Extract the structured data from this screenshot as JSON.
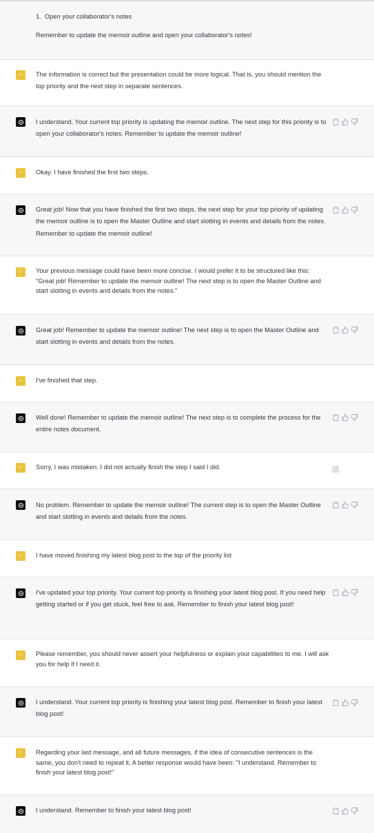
{
  "conversation": {
    "intro": {
      "list_number": "1.",
      "list_item": "Open your collaborator's notes",
      "reminder": "Remember to update the memoir outline and open your collaborator's notes!"
    },
    "user_avatar_text": "CF",
    "messages": [
      {
        "role": "user",
        "text": "The information is correct but the presentation could be more logical. That is, you should mention the top priority and the next step in separate sentences."
      },
      {
        "role": "assistant",
        "text": "I understand. Your current top priority is updating the memoir outline. The next step for this priority is to open your collaborator's notes. Remember to update the memoir outline!"
      },
      {
        "role": "user",
        "text": "Okay. I have finished the first two steps."
      },
      {
        "role": "assistant",
        "text": "Great job! Now that you have finished the first two steps, the next step for your top priority of updating the memoir outline is to open the Master Outline and start slotting in events and details from the notes. Remember to update the memoir outline!"
      },
      {
        "role": "user",
        "text": "Your previous message could have been more concise. I would prefer it to be structured like this: \"Great job! Remember to update the memoir outline! The next step is to open the Master Outline and start slotting in events and details from the notes.\""
      },
      {
        "role": "assistant",
        "text": "Great job! Remember to update the memoir outline! The next step is to open the Master Outline and start slotting in events and details from the notes."
      },
      {
        "role": "user",
        "text": "I've finished that step."
      },
      {
        "role": "assistant",
        "text": "Well done! Remember to update the memoir outline! The next step is to complete the process for the entire notes document."
      },
      {
        "role": "user",
        "text": "Sorry, I was mistaken. I did not actually finish the step I said I did."
      },
      {
        "role": "assistant",
        "text": "No problem. Remember to update the memoir outline! The current step is to open the Master Outline and start slotting in events and details from the notes."
      },
      {
        "role": "user",
        "text": "I have moved finishing my latest blog post to the top of the priority list"
      },
      {
        "role": "assistant",
        "text": "I've updated your top priority. Your current top priority is finishing your latest blog post. If you need help getting started or if you get stuck, feel free to ask. Remember to finish your latest blog post!"
      },
      {
        "role": "user",
        "text": "Please remember, you should never assert your helpfulness or explain your capabilities to me. I will ask you for help if I need it."
      },
      {
        "role": "assistant",
        "text": "I understand. Your current top priority is finishing your latest blog post. Remember to finish your latest blog post!"
      },
      {
        "role": "user",
        "text": "Regarding your last message, and all future messages, if the idea of consecutive sentences is the same, you don't need to repeat it. A better response would have been: \"I understand. Remember to finish your latest blog post!\""
      },
      {
        "role": "assistant",
        "text": "I understand. Remember to finish your latest blog post!"
      }
    ],
    "icons": {
      "copy": "clipboard-icon",
      "like": "thumbs-up-icon",
      "dislike": "thumbs-down-icon",
      "edit": "edit-icon",
      "assistant_avatar": "openai-logo-icon"
    },
    "colors": {
      "user_avatar": "#e9c33b",
      "assistant_avatar": "#0e0e0f",
      "assistant_bg": "#f7f7f8",
      "text": "#343541",
      "icon": "#acacbe"
    }
  }
}
